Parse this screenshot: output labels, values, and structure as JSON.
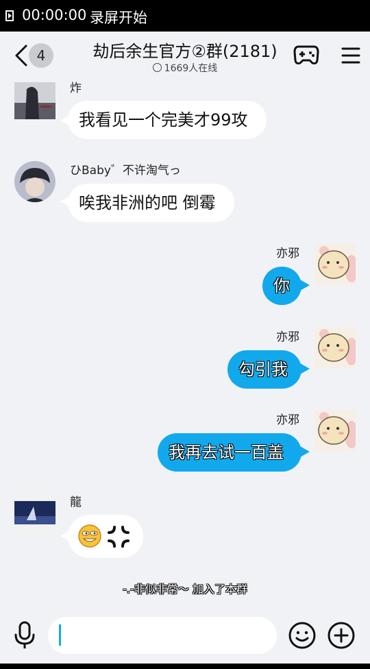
{
  "status_bar": {
    "time": "00:00:00",
    "recording_label": "录屏开始"
  },
  "header": {
    "back_badge": "4",
    "title": "劫后余生官方②群(2181)",
    "online": "1669人在线",
    "icons": [
      "back-icon",
      "gamepad-icon",
      "menu-icon"
    ]
  },
  "messages": [
    {
      "side": "left",
      "name": "炸",
      "text": "我看见一个完美才99攻"
    },
    {
      "side": "left",
      "name": "ひBaby゛不许淘气っ",
      "text": "唉我非洲的吧 倒霉"
    },
    {
      "side": "right",
      "name": "亦邪",
      "text": "你"
    },
    {
      "side": "right",
      "name": "亦邪",
      "text": "勾引我"
    },
    {
      "side": "right",
      "name": "亦邪",
      "text": "我再去试一百盖"
    },
    {
      "side": "left",
      "name": "龍",
      "text": "",
      "emojis": [
        "grin-emoji",
        "anger-emoji"
      ]
    }
  ],
  "system_notice": "-.-非似非常～ 加入了本群",
  "input_bar": {
    "placeholder": "",
    "icons": [
      "microphone-icon",
      "emoji-icon",
      "plus-icon"
    ]
  },
  "colors": {
    "accent": "#12A9EC",
    "background": "#F1F2F6",
    "bubble_left": "#FFFFFF"
  }
}
